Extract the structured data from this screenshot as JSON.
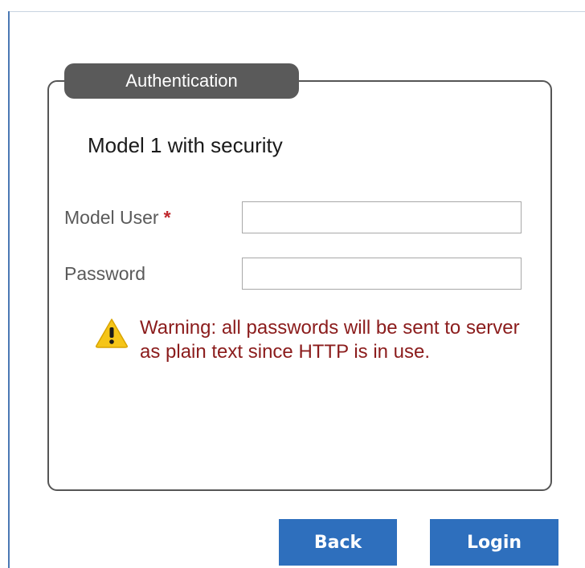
{
  "fieldset": {
    "legend": "Authentication",
    "title": "Model 1 with security"
  },
  "form": {
    "username_label": "Model User",
    "username_required_marker": "*",
    "username_value": "",
    "password_label": "Password",
    "password_value": ""
  },
  "warning": {
    "icon": "warning-triangle-icon",
    "text": "Warning: all passwords will be sent to server as plain text since HTTP is in use."
  },
  "actions": {
    "back_label": "Back",
    "login_label": "Login"
  },
  "colors": {
    "accent_button": "#2e6fbd",
    "legend_background": "#5a5a5a",
    "required_marker": "#c0282d",
    "warning_text": "#8b1c1c",
    "warning_icon": "#f5c518"
  }
}
